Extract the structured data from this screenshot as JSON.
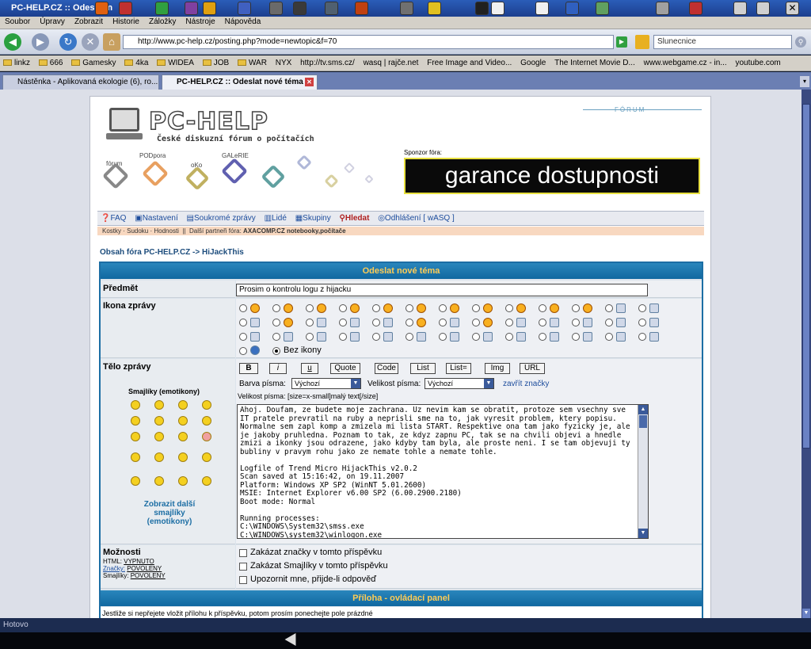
{
  "window": {
    "title": "PC-HELP.CZ :: Odeslat n"
  },
  "menu": [
    "Soubor",
    "Úpravy",
    "Zobrazit",
    "Historie",
    "Záložky",
    "Nástroje",
    "Nápověda"
  ],
  "address": {
    "url": "http://www.pc-help.cz/posting.php?mode=newtopic&f=70",
    "search": "Slunecnice"
  },
  "bookmarks": [
    "linkz",
    "666",
    "Gamesky",
    "4ka",
    "WIDEA",
    "JOB",
    "WAR",
    "NYX",
    "http://tv.sms.cz/",
    "wasq | rajče.net",
    "Free Image and Video...",
    "Google",
    "The Internet Movie D...",
    "www.webgame.cz - in...",
    "youtube.com"
  ],
  "tabs": [
    {
      "label": "Nástěnka - Aplikovaná ekologie (6), ro..."
    },
    {
      "label": "PC-HELP.CZ :: Odeslat nové téma"
    }
  ],
  "header": {
    "logo": "PC-HELP",
    "subtitle": "České diskuzní fórum o počítačích",
    "forum_tag": "FÓRUM",
    "nav_icons": [
      "fórum",
      "PODpora",
      "oKo",
      "GALeRIE"
    ],
    "sponsor_label": "Sponzor fóra:",
    "banner": "garance dostupnosti"
  },
  "topnav": [
    "FAQ",
    "Nastavení",
    "Soukromé zprávy",
    "Lidé",
    "Skupiny",
    "Hledat",
    "Odhlášení [ wASQ ]"
  ],
  "subnav": [
    "Kostky",
    "Sudoku",
    "Hodnosti",
    "Další partneři fóra:",
    "AXACOMP.CZ notebooky,počítače"
  ],
  "breadcrumb": "Obsah fóra PC-HELP.CZ -> HiJackThis",
  "form": {
    "title": "Odeslat nové téma",
    "subject_label": "Předmět",
    "subject_value": "Prosim o kontrolu logu z hijacku",
    "icon_label": "Ikona zprávy",
    "no_icon_label": "Bez ikony",
    "body_label": "Tělo zprávy",
    "smilies_title": "Smajlíky (emotikony)",
    "more_smilies": "Zobrazit další smajlíky (emotikony)",
    "buttons": [
      "B",
      "i",
      "u",
      "Quote",
      "Code",
      "List",
      "List=",
      "Img",
      "URL"
    ],
    "font_color_label": "Barva písma:",
    "font_color_value": "Výchozí",
    "font_size_label": "Velikost písma:",
    "font_size_value": "Výchozí",
    "close_tags": "zavřít značky",
    "help_line": "Velikost písma: [size=x-small]malý text[/size]",
    "message": "Ahoj. Doufam, ze budete moje zachrana. Uz nevim kam se obratit, protoze sem vsechny sve IT pratele prevratil na ruby a neprisli sme na to, jak vyresit problem, ktery popisu.\nNormalne sem zapl komp a zmizela mi lista START. Respektive ona tam jako fyzicky je, ale je jakoby pruhledna. Poznam to tak, ze kdyz zapnu PC, tak se na chvili objevi a hnedle zmizi a ikonky jsou odrazene, jako kdyby tam byla, ale proste neni. I se tam objevuji ty bubliny v pravym rohu jako ze nemate tohle a nemate tohle.\n\nLogfile of Trend Micro HijackThis v2.0.2\nScan saved at 15:16:42, on 19.11.2007\nPlatform: Windows XP SP2 (WinNT 5.01.2600)\nMSIE: Internet Explorer v6.00 SP2 (6.00.2900.2180)\nBoot mode: Normal\n\nRunning processes:\nC:\\WINDOWS\\System32\\smss.exe\nC:\\WINDOWS\\system32\\winlogon.exe",
    "options_label": "Možnosti",
    "html_label": "HTML:",
    "html_value": "VYPNUTO",
    "bbcode_label": "Značky:",
    "bbcode_value": "POVOLENY",
    "smilies_label": "Smajlíky:",
    "smilies_value": "POVOLENY",
    "opt1": "Zakázat značky v tomto příspěvku",
    "opt2": "Zakázat Smajlíky v tomto příspěvku",
    "opt3": "Upozornit mne, přijde-li odpověď",
    "attach_title": "Příloha - ovládací panel",
    "attach_note": "Jestliže si nepřejete vložit přílohu k příspěvku, potom prosím ponechejte pole prázdné"
  },
  "status": "Hotovo"
}
